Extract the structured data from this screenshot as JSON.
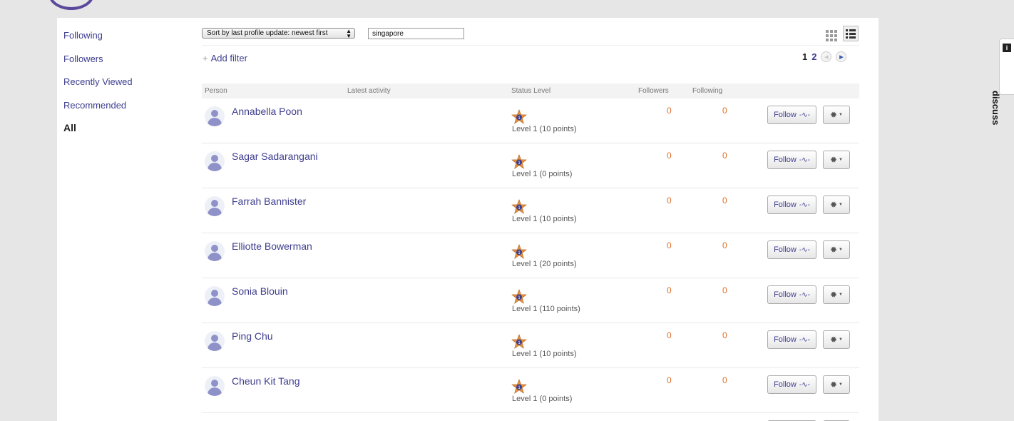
{
  "sidebar": {
    "items": [
      {
        "label": "Following"
      },
      {
        "label": "Followers"
      },
      {
        "label": "Recently Viewed"
      },
      {
        "label": "Recommended"
      },
      {
        "label": "All"
      }
    ]
  },
  "toolbar": {
    "sort_label": "Sort by last profile update: newest first",
    "search_value": "singapore",
    "add_filter_label": "Add filter"
  },
  "pagination": {
    "current": "1",
    "next": "2"
  },
  "table": {
    "headers": {
      "person": "Person",
      "latest_activity": "Latest activity",
      "status_level": "Status Level",
      "followers": "Followers",
      "following": "Following"
    },
    "rows": [
      {
        "name": "Annabella Poon",
        "level": "Level 1 (10 points)",
        "followers": "0",
        "following": "0"
      },
      {
        "name": "Sagar Sadarangani",
        "level": "Level 1 (0 points)",
        "followers": "0",
        "following": "0"
      },
      {
        "name": "Farrah Bannister",
        "level": "Level 1 (10 points)",
        "followers": "0",
        "following": "0"
      },
      {
        "name": "Elliotte Bowerman",
        "level": "Level 1 (20 points)",
        "followers": "0",
        "following": "0"
      },
      {
        "name": "Sonia Blouin",
        "level": "Level 1 (110 points)",
        "followers": "0",
        "following": "0"
      },
      {
        "name": "Ping Chu",
        "level": "Level 1 (10 points)",
        "followers": "0",
        "following": "0"
      },
      {
        "name": "Cheun Kit Tang",
        "level": "Level 1 (0 points)",
        "followers": "0",
        "following": "0"
      }
    ],
    "follow_label": "Follow"
  },
  "discuss": {
    "label": "discuss",
    "info": "i"
  },
  "colors": {
    "link": "#3e3e8f",
    "count": "#e0702a",
    "page_bg": "#e6e6e6"
  },
  "icons": [
    "logo-icon",
    "grid-view-icon",
    "list-view-icon",
    "plus-icon",
    "prev-page-icon",
    "next-page-icon",
    "avatar-icon",
    "level-star-icon",
    "pulse-icon",
    "gear-icon",
    "info-icon"
  ]
}
